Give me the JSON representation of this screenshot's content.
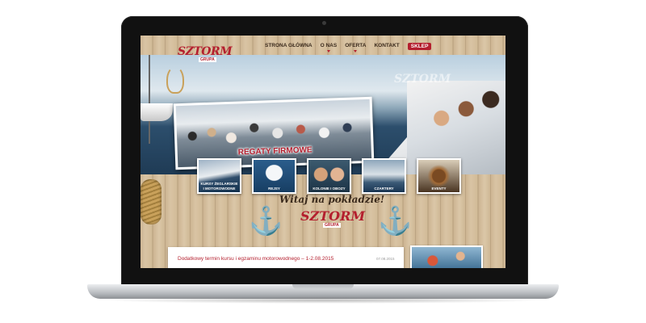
{
  "nav": {
    "logo_text": "SZTORM",
    "logo_sub": "GRUPA",
    "items": [
      {
        "label": "STRONA GŁÓWNA"
      },
      {
        "label": "O NAS"
      },
      {
        "label": "OFERTA"
      },
      {
        "label": "KONTAKT"
      }
    ],
    "shop_label": "SKLEP"
  },
  "hero": {
    "watermark": "SZTORM",
    "caption": "REGATY FIRMOWE"
  },
  "tiles": [
    {
      "label": "KURSY ŻEGLARSKIE I MOTOROWODNE"
    },
    {
      "label": "REJSY"
    },
    {
      "label": "KOLONIE I OBOZY"
    },
    {
      "label": "CZARTERY"
    },
    {
      "label": "EVENTY"
    }
  ],
  "welcome": "Witaj na pokładzie!",
  "footer_logo": {
    "text": "SZTORM",
    "sub": "GRUPA"
  },
  "news": {
    "title": "Dodatkowy termin kursu i egzaminu motorowodnego – 1-2.08.2015",
    "date": "07.08.2015"
  },
  "colors": {
    "brand_red": "#b41f2e",
    "wood": "#cdb593",
    "navy": "#16324f"
  },
  "icons": [
    "anchor-icon",
    "rope-icon"
  ]
}
